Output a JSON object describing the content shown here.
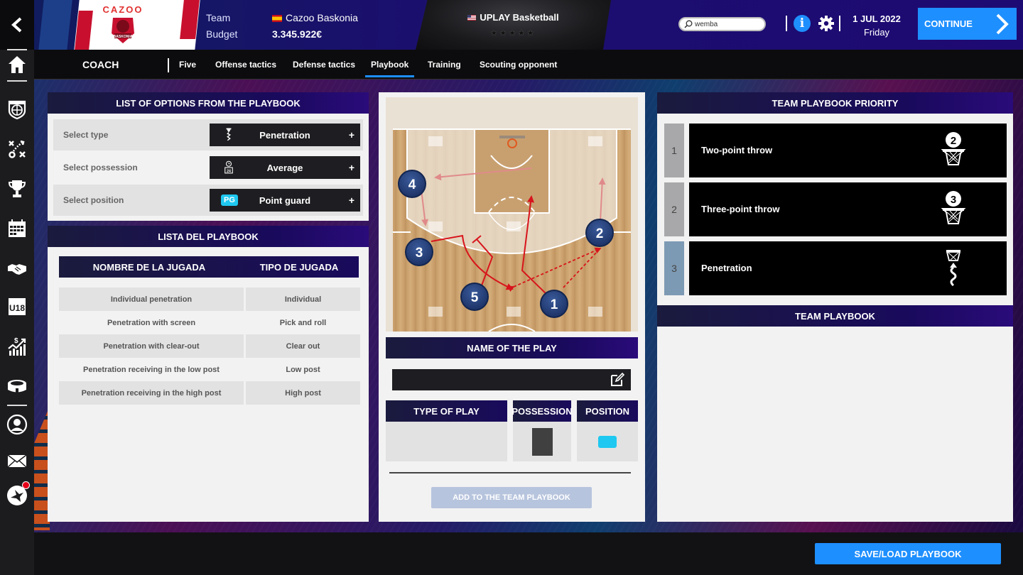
{
  "header": {
    "club_brand": "CAZOO",
    "club_logo_text": "BASKONIA",
    "team_label": "Team",
    "budget_label": "Budget",
    "team_name": "Cazoo Baskonia",
    "budget_value": "3.345.922€",
    "league_name": "UPLAY Basketball",
    "league_stars": "★★★★★",
    "search_value": "wemba",
    "date": "1 JUL 2022",
    "weekday": "Friday",
    "continue_label": "CONTINUE"
  },
  "sidebar": {
    "items": [
      {
        "icon": "home-icon"
      },
      {
        "icon": "team-shield-icon"
      },
      {
        "icon": "tactics-icon"
      },
      {
        "icon": "trophy-icon"
      },
      {
        "icon": "calendar-icon"
      },
      {
        "icon": "handshake-icon"
      },
      {
        "icon": "u18-icon",
        "label": "U18"
      },
      {
        "icon": "finances-icon"
      },
      {
        "icon": "stadium-icon"
      },
      {
        "icon": "profile-icon"
      },
      {
        "icon": "mail-icon"
      },
      {
        "icon": "news-bird-icon",
        "has_notification": true
      }
    ]
  },
  "subnav": {
    "section": "COACH",
    "tabs": [
      {
        "label": "Five",
        "active": false
      },
      {
        "label": "Offense tactics",
        "active": false
      },
      {
        "label": "Defense tactics",
        "active": false
      },
      {
        "label": "Playbook",
        "active": true
      },
      {
        "label": "Training",
        "active": false
      },
      {
        "label": "Scouting opponent",
        "active": false
      }
    ]
  },
  "options_panel": {
    "title": "LIST OF OPTIONS FROM THE PLAYBOOK",
    "rows": [
      {
        "label": "Select type",
        "value": "Penetration",
        "icon": "penetration-icon"
      },
      {
        "label": "Select possession",
        "value": "Average",
        "icon": "shot-clock-icon"
      },
      {
        "label": "Select position",
        "value": "Point guard",
        "badge": "PG"
      }
    ],
    "plus": "+"
  },
  "playbook_list": {
    "title": "LISTA DEL PLAYBOOK",
    "columns": [
      "NOMBRE DE LA JUGADA",
      "TIPO DE JUGADA"
    ],
    "rows": [
      {
        "name": "Individual penetration",
        "type": "Individual"
      },
      {
        "name": "Penetration with screen",
        "type": "Pick and roll"
      },
      {
        "name": "Penetration with clear-out",
        "type": "Clear out"
      },
      {
        "name": "Penetration receiving in the low post",
        "type": "Low post"
      },
      {
        "name": "Penetration receiving in the high post",
        "type": "High post"
      }
    ]
  },
  "play_editor": {
    "players": [
      "1",
      "2",
      "3",
      "4",
      "5"
    ],
    "name_header": "NAME OF THE PLAY",
    "name_value": "",
    "columns": [
      "TYPE OF PLAY",
      "POSSESSION",
      "POSITION"
    ],
    "add_label": "ADD TO THE TEAM PLAYBOOK"
  },
  "priority_panel": {
    "title": "TEAM PLAYBOOK PRIORITY",
    "rows": [
      {
        "rank": "1",
        "label": "Two-point throw",
        "icon": "two-point-basket-icon",
        "icon_text": "2"
      },
      {
        "rank": "2",
        "label": "Three-point throw",
        "icon": "three-point-basket-icon",
        "icon_text": "3"
      },
      {
        "rank": "3",
        "label": "Penetration",
        "icon": "penetration-basket-icon"
      }
    ],
    "team_playbook_title": "TEAM PLAYBOOK"
  },
  "footer": {
    "save_load_label": "SAVE/LOAD PLAYBOOK"
  },
  "colors": {
    "accent_blue": "#1e8fff",
    "panel_header": "#190a5c",
    "play_arrow": "#d8141c",
    "player_marker": "#1f3a70",
    "position_badge": "#1ec8f0",
    "notification": "#e6001a"
  }
}
